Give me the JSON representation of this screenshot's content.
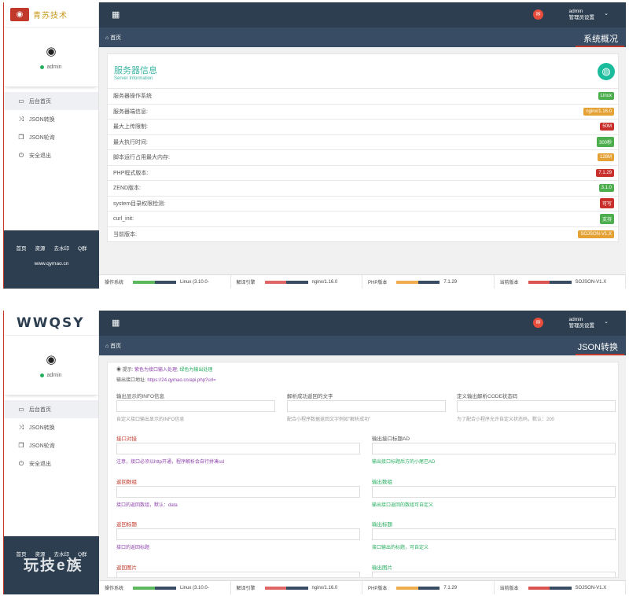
{
  "colors": {
    "dark": "#2c3e50",
    "teal": "#3bb5a3",
    "red": "#c0392b",
    "green": "#27ae60",
    "orange": "#e5a133"
  },
  "shot1": {
    "logo_text": "青苏技术",
    "admin": "admin",
    "admin_sub": "管理员设置",
    "breadcrumb": "首页",
    "section_title": "系统概况",
    "profile_name": "admin",
    "menu": [
      {
        "icon": "laptop-icon",
        "label": "后台首页"
      },
      {
        "icon": "shuffle-icon",
        "label": "JSON转换"
      },
      {
        "icon": "copy-icon",
        "label": "JSON轮询"
      },
      {
        "icon": "power-icon",
        "label": "安全退出"
      }
    ],
    "footer_links": [
      "首页",
      "资源",
      "去水印",
      "Q群"
    ],
    "footer_site": "www.qymao.cn",
    "info_title": "服务器信息",
    "info_sub": "Server Information",
    "rows": [
      {
        "label": "服务器操作系统",
        "value": "Linux",
        "color": "#4cae4c"
      },
      {
        "label": "服务器端信息:",
        "value": "nginx/1.16.0",
        "color": "#e5a133"
      },
      {
        "label": "最大上传限制:",
        "value": "50M",
        "color": "#c9302c"
      },
      {
        "label": "最大执行时间:",
        "value": "300秒",
        "color": "#4cae4c"
      },
      {
        "label": "脚本运行占用最大内存:",
        "value": "128M",
        "color": "#e5a133"
      },
      {
        "label": "PHP程式版本:",
        "value": "7.1.29",
        "color": "#c9302c"
      },
      {
        "label": "ZEND版本:",
        "value": "3.1.0",
        "color": "#4cae4c"
      },
      {
        "label": "system目录权限检测:",
        "value": "可写",
        "color": "#c9302c"
      },
      {
        "label": "curl_init:",
        "value": "支持",
        "color": "#4cae4c"
      },
      {
        "label": "当前版本:",
        "value": "SOJSON-V1.X",
        "color": "#e5a133"
      }
    ]
  },
  "status": [
    {
      "label": "操作系统",
      "value": "Linux (3.10.0-",
      "colors": [
        "#5cb85c",
        "#384d63"
      ]
    },
    {
      "label": "解译引擎",
      "value": "nginx/1.16.0",
      "colors": [
        "#e06666",
        "#384d63"
      ]
    },
    {
      "label": "PHP版本",
      "value": "7.1.29",
      "colors": [
        "#f0ad4e",
        "#384d63"
      ]
    },
    {
      "label": "当前版本",
      "value": "SOJSON-V1.X",
      "colors": [
        "#d9534f",
        "#384d63"
      ]
    }
  ],
  "shot2": {
    "logo_text": "WWQSY",
    "admin": "admin",
    "admin_sub": "管理员设置",
    "breadcrumb": "首页",
    "section_title": "JSON转换",
    "profile_name": "admin",
    "menu": [
      {
        "icon": "laptop-icon",
        "label": "后台首页"
      },
      {
        "icon": "shuffle-icon",
        "label": "JSON转换"
      },
      {
        "icon": "copy-icon",
        "label": "JSON轮询"
      },
      {
        "icon": "power-icon",
        "label": "安全退出"
      }
    ],
    "footer_links": [
      "首页",
      "资源",
      "去水印",
      "Q群"
    ],
    "tip_prefix": "提示:",
    "tip_purple": "紫色为接口输入处理",
    "tip_green": "绿色为输出处理",
    "api_label": "输出接口地址:",
    "api_url": "https://24.qymao.cn/api.php?url=",
    "top_fields": [
      {
        "label": "输出显示的INFO信息",
        "hint": "自定义接口输出显示的INFO信息"
      },
      {
        "label": "解析成功返回的文字",
        "hint": "配合小程序数据返回文字例如\"解析成功\""
      },
      {
        "label": "定义输出解析CODE状态码",
        "hint": "为了配合小程序允许自定义状态码，默认：200"
      }
    ],
    "left_fields": [
      {
        "label": "接口对接",
        "hint": "注意，接口必须以http开通，程序解析会自行拼凑ssl"
      },
      {
        "label": "返回数组",
        "hint": "接口的返回数组，默认：data"
      },
      {
        "label": "返回标题",
        "hint": "接口的返回标题"
      },
      {
        "label": "返回图片",
        "hint": ""
      }
    ],
    "right_fields": [
      {
        "label": "输出接口标题AD",
        "hint": "输出接口标题后方的小尾巴AD"
      },
      {
        "label": "输出数组",
        "hint": "输出接口返回的数组可自定义"
      },
      {
        "label": "输出标题",
        "hint": "接口输出的标题，可自定义"
      },
      {
        "label": "输出图片",
        "hint": ""
      }
    ]
  },
  "watermark": "玩技e族"
}
